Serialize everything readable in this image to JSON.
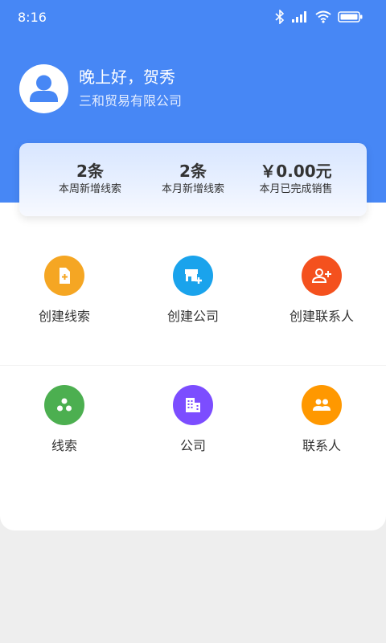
{
  "status_bar": {
    "time": "8:16"
  },
  "profile": {
    "greeting": "晚上好，贺秀",
    "company": "三和贸易有限公司"
  },
  "stats": [
    {
      "value": "2条",
      "label": "本周新增线索"
    },
    {
      "value": "2条",
      "label": "本月新增线索"
    },
    {
      "value": "￥0.00元",
      "label": "本月已完成销售"
    }
  ],
  "actions": [
    {
      "label": "创建线索",
      "icon": "add-file-icon",
      "color": "#f5a623"
    },
    {
      "label": "创建公司",
      "icon": "add-store-icon",
      "color": "#1aa3ec"
    },
    {
      "label": "创建联系人",
      "icon": "add-person-icon",
      "color": "#f4511e"
    },
    {
      "label": "线索",
      "icon": "leads-icon",
      "color": "#4caf50"
    },
    {
      "label": "公司",
      "icon": "building-icon",
      "color": "#7c4dff"
    },
    {
      "label": "联系人",
      "icon": "contacts-icon",
      "color": "#ff9800"
    }
  ],
  "colors": {
    "header": "#4787f5",
    "background": "#eeeeee"
  }
}
